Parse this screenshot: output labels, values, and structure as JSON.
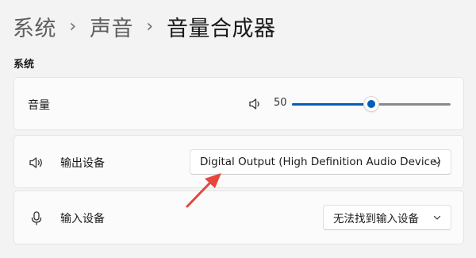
{
  "breadcrumb": {
    "items": [
      "系统",
      "声音"
    ],
    "separator": "›",
    "current": "音量合成器"
  },
  "section": {
    "title": "系统"
  },
  "volume": {
    "label": "音量",
    "value": "50",
    "level_percent": 50,
    "icon": "speaker-icon"
  },
  "output": {
    "label": "输出设备",
    "selected": "Digital Output (High Definition Audio Device)",
    "icon": "speaker-icon"
  },
  "input": {
    "label": "输入设备",
    "selected": "无法找到输入设备",
    "icon": "microphone-icon"
  },
  "colors": {
    "accent": "#005fb8",
    "annotation_arrow": "#e8463a",
    "background": "#f3f3f3",
    "card": "#fbfbfb"
  }
}
